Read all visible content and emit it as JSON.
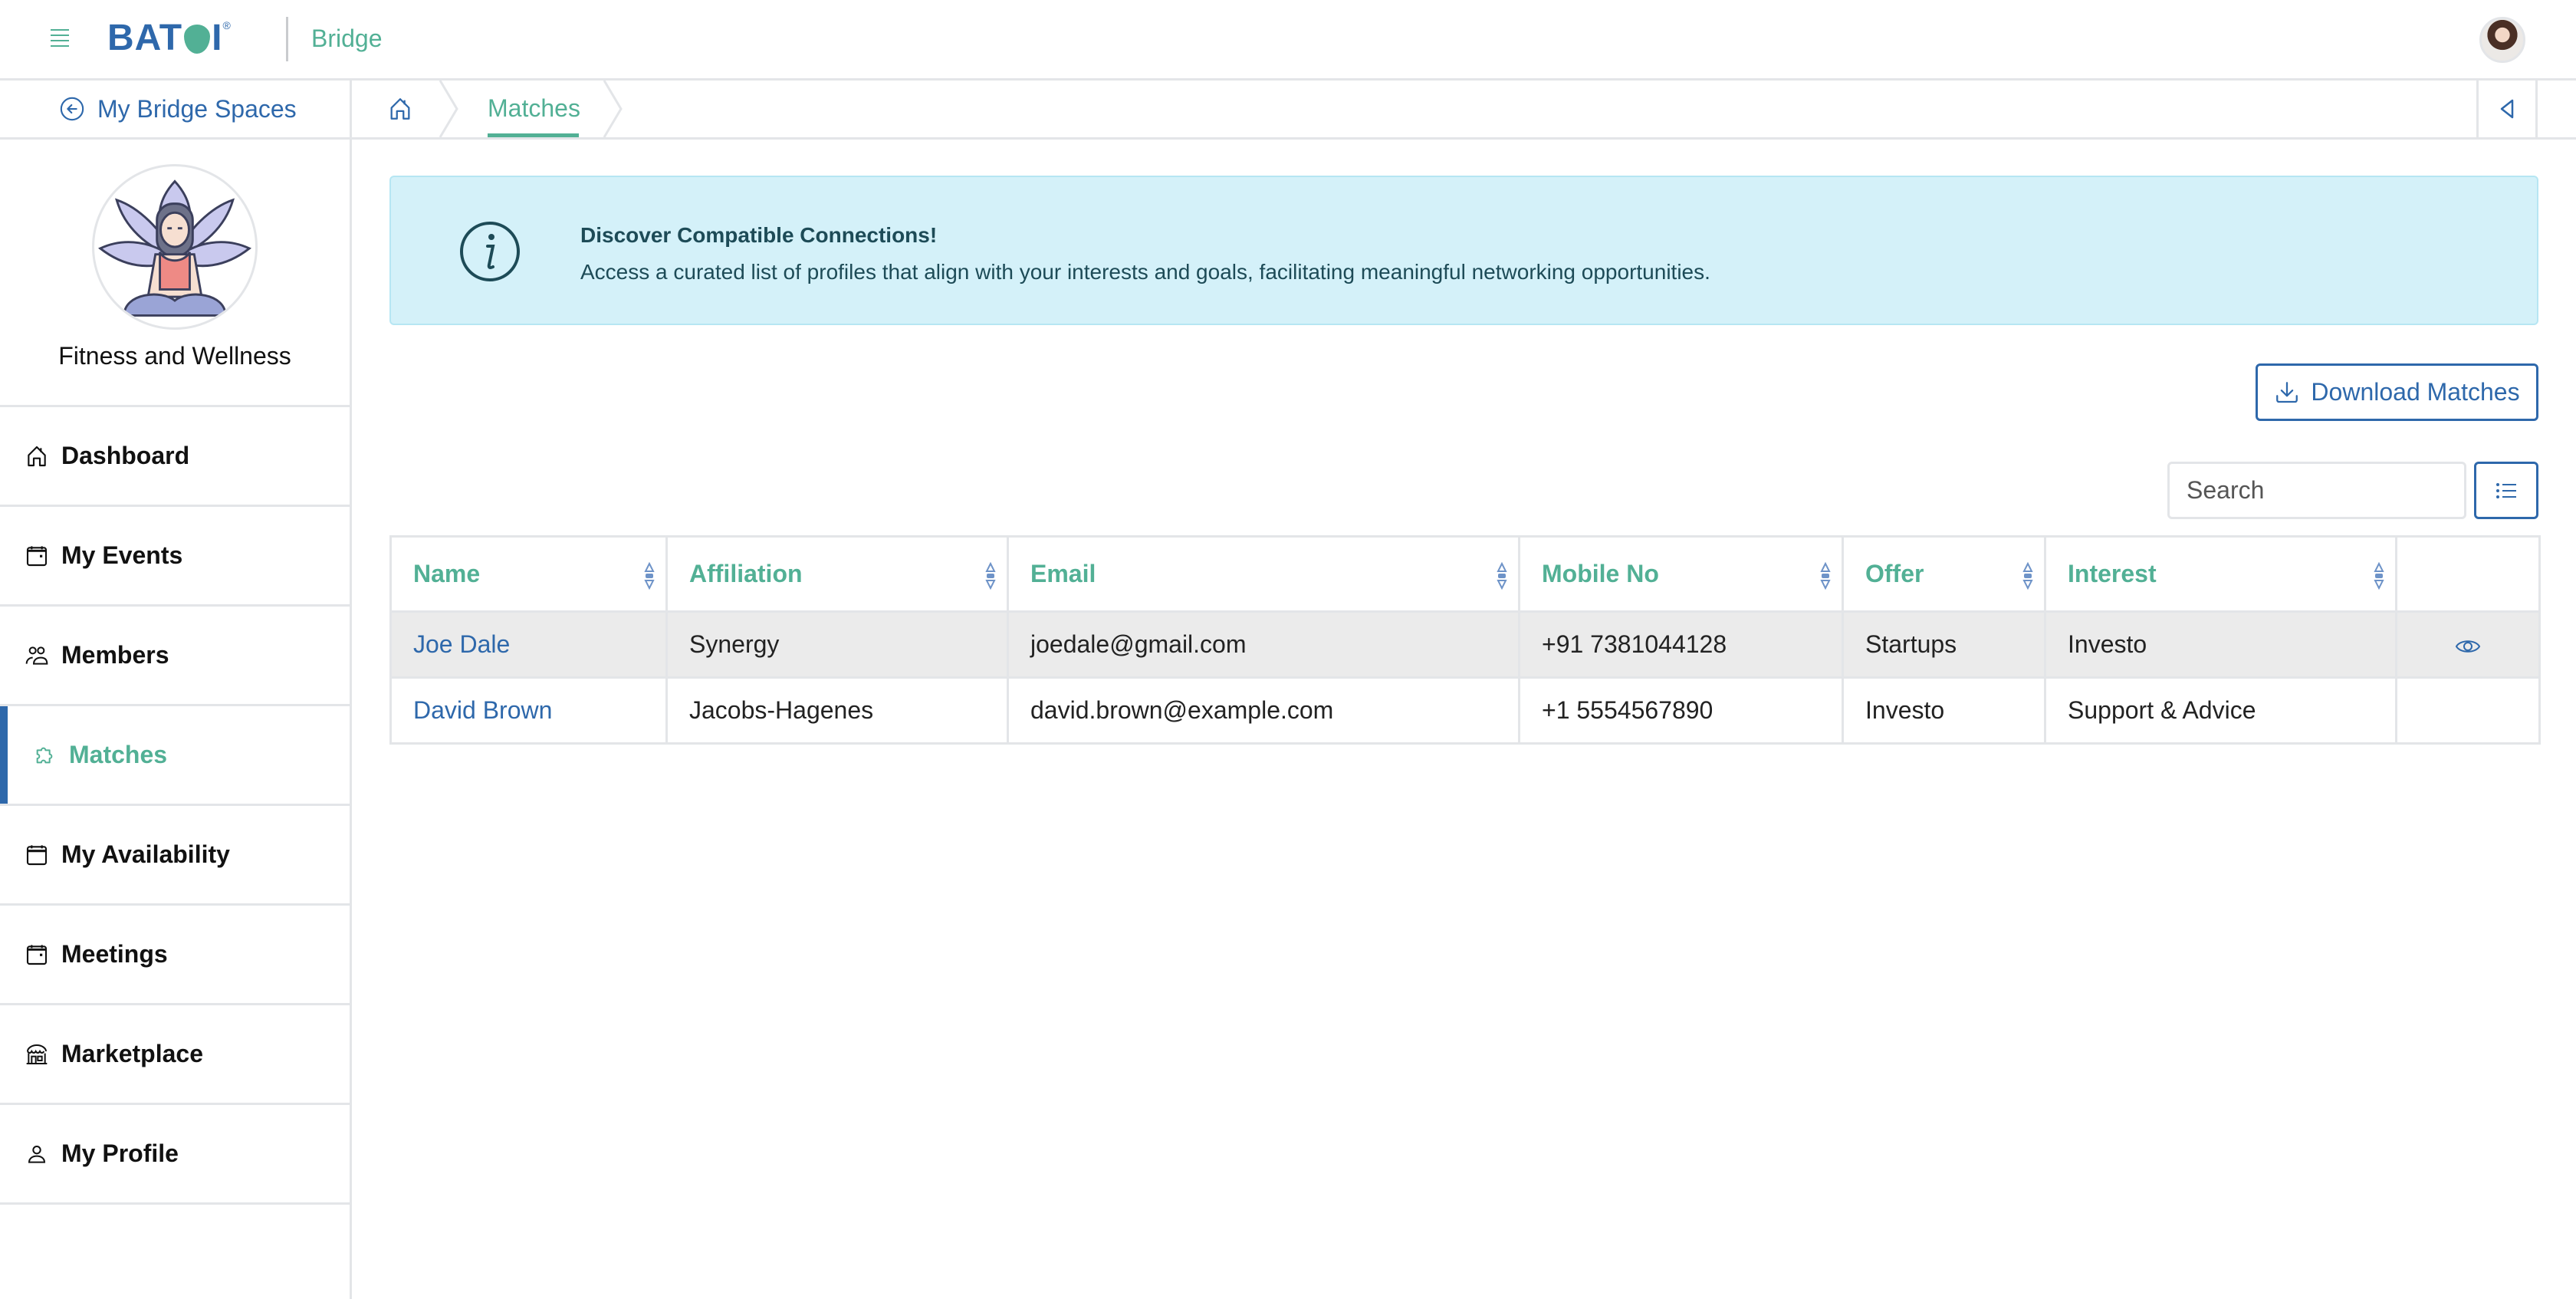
{
  "header": {
    "logo_text": "BATOI",
    "app_name": "Bridge",
    "menu_icon": "hamburger-icon",
    "user_avatar": "user-avatar"
  },
  "breadcrumb": {
    "back_label": "My Bridge Spaces",
    "home_icon": "home-icon",
    "current": "Matches",
    "collapse_icon": "triangle-left-icon"
  },
  "sidebar": {
    "space_name": "Fitness and Wellness",
    "items": [
      {
        "label": "Dashboard",
        "icon": "home-icon",
        "active": false
      },
      {
        "label": "My Events",
        "icon": "calendar-icon",
        "active": false
      },
      {
        "label": "Members",
        "icon": "users-icon",
        "active": false
      },
      {
        "label": "Matches",
        "icon": "puzzle-icon",
        "active": true
      },
      {
        "label": "My Availability",
        "icon": "calendar-blank-icon",
        "active": false
      },
      {
        "label": "Meetings",
        "icon": "calendar-icon",
        "active": false
      },
      {
        "label": "Marketplace",
        "icon": "store-icon",
        "active": false
      },
      {
        "label": "My Profile",
        "icon": "user-icon",
        "active": false
      }
    ]
  },
  "banner": {
    "icon": "info-icon",
    "title": "Discover Compatible Connections!",
    "text": "Access a curated list of profiles that align with your interests and goals, facilitating meaningful networking opportunities."
  },
  "toolbar": {
    "download_label": "Download Matches",
    "download_icon": "download-icon",
    "search_placeholder": "Search",
    "search_value": "",
    "columns_icon": "list-icon"
  },
  "table": {
    "columns": [
      "Name",
      "Affiliation",
      "Email",
      "Mobile No",
      "Offer",
      "Interest",
      ""
    ],
    "rows": [
      {
        "name": "Joe Dale",
        "affiliation": "Synergy",
        "email": "joedale@gmail.com",
        "mobile": "+91 7381044128",
        "offer": "Startups",
        "interest": "Investo",
        "action_icon": "eye-icon"
      },
      {
        "name": "David Brown",
        "affiliation": "Jacobs-Hagenes",
        "email": "david.brown@example.com",
        "mobile": "+1 5554567890",
        "offer": "Investo",
        "interest": "Support & Advice",
        "action_icon": ""
      }
    ]
  },
  "colors": {
    "primary_blue": "#2e68ab",
    "accent_green": "#52b095",
    "banner_bg": "#d4f1f9",
    "border": "#e3e5e8",
    "row_highlight": "#ebebeb"
  }
}
